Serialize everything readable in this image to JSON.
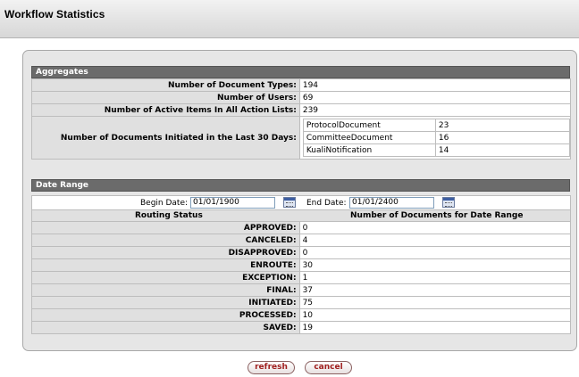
{
  "header": {
    "title": "Workflow Statistics"
  },
  "aggregates": {
    "title": "Aggregates",
    "rows": [
      {
        "label": "Number of Document Types:",
        "value": "194"
      },
      {
        "label": "Number of Users:",
        "value": "69"
      },
      {
        "label": "Number of Active Items In All Action Lists:",
        "value": "239"
      }
    ],
    "initiated": {
      "label": "Number of Documents Initiated in the Last 30 Days:",
      "items": [
        {
          "name": "ProtocolDocument",
          "count": "23"
        },
        {
          "name": "CommitteeDocument",
          "count": "16"
        },
        {
          "name": "KualiNotification",
          "count": "14"
        }
      ]
    }
  },
  "date_range": {
    "title": "Date Range",
    "begin_label": "Begin Date:",
    "begin_value": "01/01/1900",
    "end_label": "End Date:",
    "end_value": "01/01/2400",
    "col_status": "Routing Status",
    "col_count": "Number of Documents for Date Range",
    "rows": [
      {
        "status": "APPROVED:",
        "count": "0"
      },
      {
        "status": "CANCELED:",
        "count": "4"
      },
      {
        "status": "DISAPPROVED:",
        "count": "0"
      },
      {
        "status": "ENROUTE:",
        "count": "30"
      },
      {
        "status": "EXCEPTION:",
        "count": "1"
      },
      {
        "status": "FINAL:",
        "count": "37"
      },
      {
        "status": "INITIATED:",
        "count": "75"
      },
      {
        "status": "PROCESSED:",
        "count": "10"
      },
      {
        "status": "SAVED:",
        "count": "19"
      }
    ]
  },
  "buttons": {
    "refresh": "refresh",
    "cancel": "cancel"
  }
}
